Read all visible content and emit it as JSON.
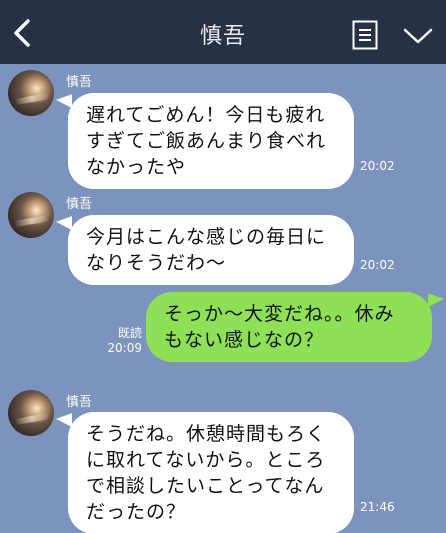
{
  "header": {
    "title": "慎吾",
    "back_icon": "chevron-left-icon",
    "memo_icon": "note-icon",
    "menu_icon": "chevron-down-icon",
    "background": "#263145"
  },
  "chat": {
    "background": "#7b93bd",
    "incoming_bubble_color": "#ffffff",
    "outgoing_bubble_color": "#8ee157",
    "messages": [
      {
        "direction": "in",
        "sender": "慎吾",
        "lines": [
          "遅れてごめん！今日も疲れ",
          "すぎてご飯あんまり食べれ",
          "なかったや"
        ],
        "time": "20:02"
      },
      {
        "direction": "in",
        "sender": "慎吾",
        "lines": [
          "今月はこんな感じの毎日に",
          "なりそうだわ〜"
        ],
        "time": "20:02"
      },
      {
        "direction": "out",
        "lines": [
          "そっか〜大変だね。。休み",
          "もない感じなの？"
        ],
        "read": "既読",
        "time": "20:09"
      },
      {
        "direction": "in",
        "sender": "慎吾",
        "lines": [
          "そうだね。休憩時間もろく",
          "に取れてないから。ところ",
          "で相談したいことってなん",
          "だったの？"
        ],
        "time": "21:46"
      }
    ]
  }
}
